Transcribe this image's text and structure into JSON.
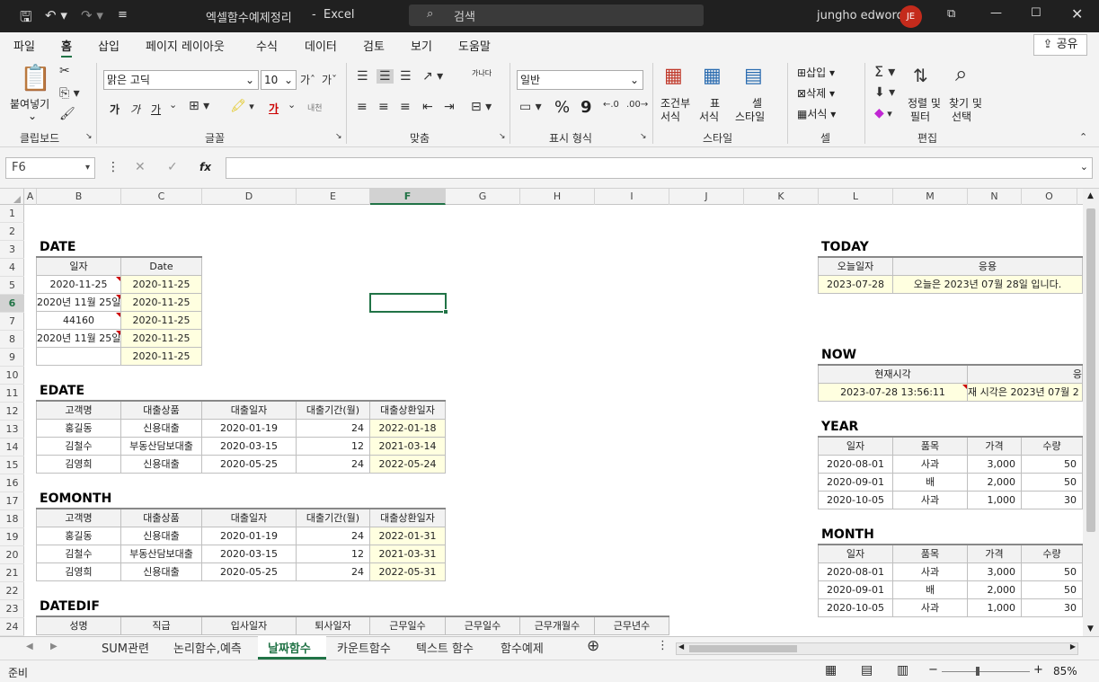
{
  "titlebar": {
    "filename": "엑셀함수예제정리",
    "sep": "-",
    "app": "Excel",
    "search_placeholder": "검색",
    "user": "jungho edword",
    "initials": "JE"
  },
  "tabs": [
    "파일",
    "홈",
    "삽입",
    "페이지 레이아웃",
    "수식",
    "데이터",
    "검토",
    "보기",
    "도움말"
  ],
  "share": "공유",
  "ribbon": {
    "paste": "붙여넣기",
    "clipboard": "클립보드",
    "font_name": "맑은 고딕",
    "font_size": "10",
    "font": "글꼴",
    "bold": "가",
    "italic": "가",
    "underline": "가",
    "font_color": "가",
    "phonetic": "내천",
    "wrap": "가나다",
    "align": "맞춤",
    "number_format": "일반",
    "number": "표시 형식",
    "percent": "%",
    "comma": "9",
    "cond1": "조건부",
    "cond2": "서식",
    "table1": "표",
    "table2": "서식",
    "cellstyle1": "셀",
    "cellstyle2": "스타일",
    "styles": "스타일",
    "insert": "삽입",
    "delete": "삭제",
    "format": "서식",
    "cells": "셀",
    "sort1": "정렬 및",
    "sort2": "필터",
    "find1": "찾기 및",
    "find2": "선택",
    "editing": "편집"
  },
  "namebox": "F6",
  "fx": "fx",
  "columns": [
    "A",
    "B",
    "C",
    "D",
    "E",
    "F",
    "G",
    "H",
    "I",
    "J",
    "K",
    "L",
    "M",
    "N",
    "O"
  ],
  "rows": [
    "1",
    "2",
    "3",
    "4",
    "5",
    "6",
    "7",
    "8",
    "9",
    "10",
    "11",
    "12",
    "13",
    "14",
    "15",
    "16",
    "17",
    "18",
    "19",
    "20",
    "21",
    "22",
    "23",
    "24"
  ],
  "date": {
    "title": "DATE",
    "h1": "일자",
    "h2": "Date",
    "rows": [
      [
        "2020-11-25",
        "2020-11-25"
      ],
      [
        "2020년 11월 25일",
        "2020-11-25"
      ],
      [
        "44160",
        "2020-11-25"
      ],
      [
        "2020년 11월 25일",
        "2020-11-25"
      ],
      [
        "",
        "2020-11-25"
      ]
    ]
  },
  "edate": {
    "title": "EDATE",
    "headers": [
      "고객명",
      "대출상품",
      "대출일자",
      "대출기간(월)",
      "대출상환일자"
    ],
    "rows": [
      [
        "홍길동",
        "신용대출",
        "2020-01-19",
        "24",
        "2022-01-18"
      ],
      [
        "김철수",
        "부동산담보대출",
        "2020-03-15",
        "12",
        "2021-03-14"
      ],
      [
        "김영희",
        "신용대출",
        "2020-05-25",
        "24",
        "2022-05-24"
      ]
    ]
  },
  "eomonth": {
    "title": "EOMONTH",
    "headers": [
      "고객명",
      "대출상품",
      "대출일자",
      "대출기간(월)",
      "대출상환일자"
    ],
    "rows": [
      [
        "홍길동",
        "신용대출",
        "2020-01-19",
        "24",
        "2022-01-31"
      ],
      [
        "김철수",
        "부동산담보대출",
        "2020-03-15",
        "12",
        "2021-03-31"
      ],
      [
        "김영희",
        "신용대출",
        "2020-05-25",
        "24",
        "2022-05-31"
      ]
    ]
  },
  "datedif": {
    "title": "DATEDIF",
    "headers": [
      "성명",
      "직급",
      "입사일자",
      "퇴사일자",
      "근무일수",
      "근무일수",
      "근무개월수",
      "근무년수"
    ]
  },
  "today": {
    "title": "TODAY",
    "h1": "오늘일자",
    "h2": "응용",
    "v1": "2023-07-28",
    "v2": "오늘은 2023년 07월 28일 입니다."
  },
  "now": {
    "title": "NOW",
    "h1": "현재시각",
    "h2": "응",
    "v1": "2023-07-28 13:56:11",
    "v2": "재 시각은 2023년 07월 2"
  },
  "year": {
    "title": "YEAR",
    "headers": [
      "일자",
      "품목",
      "가격",
      "수량"
    ],
    "rows": [
      [
        "2020-08-01",
        "사과",
        "3,000",
        "50"
      ],
      [
        "2020-09-01",
        "배",
        "2,000",
        "50"
      ],
      [
        "2020-10-05",
        "사과",
        "1,000",
        "30"
      ]
    ]
  },
  "month": {
    "title": "MONTH",
    "headers": [
      "일자",
      "품목",
      "가격",
      "수량"
    ],
    "rows": [
      [
        "2020-08-01",
        "사과",
        "3,000",
        "50"
      ],
      [
        "2020-09-01",
        "배",
        "2,000",
        "50"
      ],
      [
        "2020-10-05",
        "사과",
        "1,000",
        "30"
      ]
    ]
  },
  "sheets": [
    "SUM관련",
    "논리함수,예측",
    "날짜함수",
    "카운트함수",
    "텍스트 함수",
    "함수예제"
  ],
  "status": {
    "ready": "준비",
    "zoom": "85%",
    "minus": "−",
    "plus": "+"
  }
}
